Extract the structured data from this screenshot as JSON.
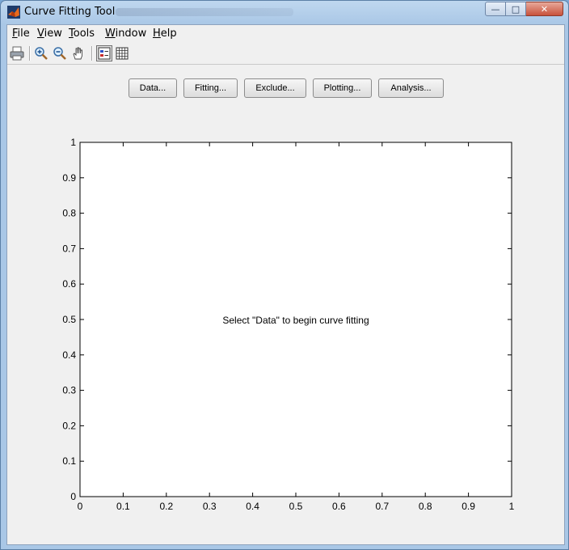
{
  "window": {
    "title": "Curve Fitting Tool",
    "caption_buttons": {
      "minimize": "—",
      "maximize": "□",
      "close": "✕"
    }
  },
  "menu": [
    {
      "label": "File",
      "mnemonic": "F",
      "rest": "ile"
    },
    {
      "label": "View",
      "mnemonic": "V",
      "rest": "iew"
    },
    {
      "label": "Tools",
      "mnemonic": "T",
      "rest": "ools"
    },
    {
      "label": "Window",
      "mnemonic": "W",
      "rest": "indow"
    },
    {
      "label": "Help",
      "mnemonic": "H",
      "rest": "elp"
    }
  ],
  "toolbar": {
    "icons": [
      "print-icon",
      "zoom-in-icon",
      "zoom-out-icon",
      "pan-hand-icon",
      "legend-toggle-icon",
      "grid-toggle-icon"
    ]
  },
  "buttons": {
    "data": "Data...",
    "fitting": "Fitting...",
    "exclude": "Exclude...",
    "plotting": "Plotting...",
    "analysis": "Analysis..."
  },
  "plot": {
    "message": "Select \"Data\" to begin curve fitting",
    "colors": {
      "axes_bg": "#ffffff",
      "axes_line": "#000000",
      "figure_bg": "#f0f0f0"
    }
  },
  "chart_data": {
    "type": "scatter",
    "series": [],
    "xlim": [
      0,
      1
    ],
    "ylim": [
      0,
      1
    ],
    "x_ticks": [
      "0",
      "0.1",
      "0.2",
      "0.3",
      "0.4",
      "0.5",
      "0.6",
      "0.7",
      "0.8",
      "0.9",
      "1"
    ],
    "y_ticks": [
      "0",
      "0.1",
      "0.2",
      "0.3",
      "0.4",
      "0.5",
      "0.6",
      "0.7",
      "0.8",
      "0.9",
      "1"
    ],
    "grid": false,
    "annotation": "Select \"Data\" to begin curve fitting"
  }
}
